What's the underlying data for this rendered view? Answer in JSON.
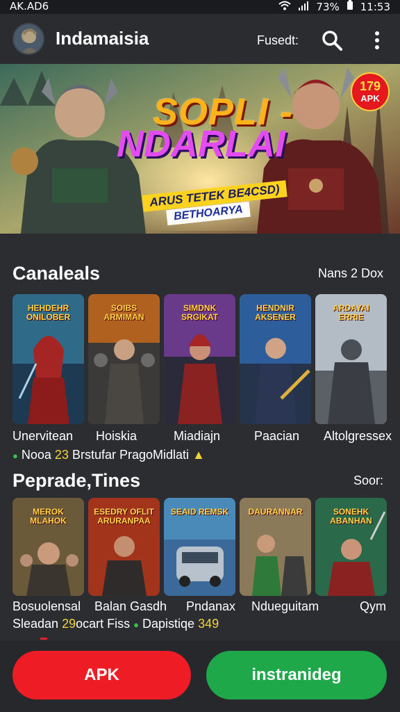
{
  "status_bar": {
    "carrier": "AK.AD6",
    "battery": "73%",
    "time": "11:53"
  },
  "app_bar": {
    "title": "Indamaisia",
    "filter_label": "Fusedt:"
  },
  "banner": {
    "headline_line1": "SOPLI -",
    "headline_line2": "NDARLAI",
    "tagline1": "ARUS TETEK BE4CSD)",
    "tagline2": "BETHOARYA",
    "badge_number": "179",
    "badge_label": "APK"
  },
  "section1": {
    "title": "Canaleals",
    "link": "Nans 2 Dox",
    "cards": [
      {
        "logo": "HEHDEHR ONILOBER",
        "name": "Unervitean"
      },
      {
        "logo": "SOIBS ARMIMAN",
        "name": "Hoiskia"
      },
      {
        "logo": "SIMDNK SRGIKAT",
        "name": "Miadiajn"
      },
      {
        "logo": "HENDNIR AKSENER",
        "name": "Paacian"
      },
      {
        "logo": "ARDAYAI ERRIE",
        "name": "Altolgressex"
      }
    ],
    "meta": {
      "part1": "Nooa",
      "part2": "23",
      "part3": "Brstufar PragoMidlati"
    }
  },
  "section2": {
    "title": "Peprade,Tines",
    "link": "Soor:",
    "cards": [
      {
        "logo": "MEROK MLAHOK"
      },
      {
        "logo": "ESEDRY OFLIT ARURANPAA"
      },
      {
        "logo": "SEAID REMSK"
      },
      {
        "logo": "DAURANNAR"
      },
      {
        "logo": "SONEHK ABANHAN"
      }
    ],
    "names_line": [
      "Bosuolensal",
      "Balan Gasdh",
      "Pndanax",
      "Ndueguitam",
      "Qym"
    ],
    "meta": {
      "part1": "Sleadan",
      "part2": "29",
      "part3": "ocart Fiss",
      "part4": "Dapistiqe",
      "part5": "349"
    }
  },
  "bottom": {
    "apk_label": "APK",
    "install_label": "instranideg"
  },
  "colors": {
    "apk_button": "#ee1c25",
    "install_button": "#1ea84a",
    "background": "#2b2d31"
  }
}
